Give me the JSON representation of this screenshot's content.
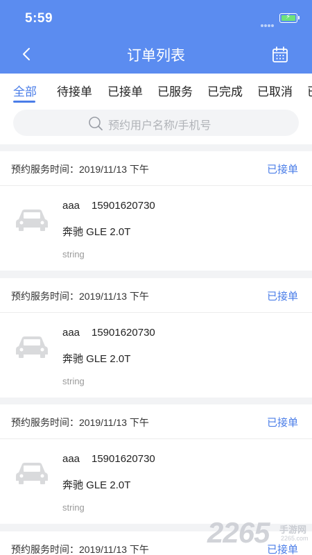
{
  "status_bar": {
    "time": "5:59"
  },
  "header": {
    "title": "订单列表"
  },
  "tabs": [
    {
      "label": "全部",
      "active": true
    },
    {
      "label": "待接单"
    },
    {
      "label": "已接单"
    },
    {
      "label": "已服务"
    },
    {
      "label": "已完成"
    },
    {
      "label": "已取消"
    },
    {
      "label": "已"
    }
  ],
  "search": {
    "placeholder": "预约用户名称/手机号"
  },
  "orders": [
    {
      "time_label": "预约服务时间：",
      "time": "2019/11/13 下午",
      "status": "已接单",
      "name": "aaa",
      "phone": "15901620730",
      "car": "奔驰 GLE 2.0T",
      "note": "string"
    },
    {
      "time_label": "预约服务时间：",
      "time": "2019/11/13 下午",
      "status": "已接单",
      "name": "aaa",
      "phone": "15901620730",
      "car": "奔驰 GLE 2.0T",
      "note": "string"
    },
    {
      "time_label": "预约服务时间：",
      "time": "2019/11/13 下午",
      "status": "已接单",
      "name": "aaa",
      "phone": "15901620730",
      "car": "奔驰 GLE 2.0T",
      "note": "string"
    },
    {
      "time_label": "预约服务时间：",
      "time": "2019/11/13 下午",
      "status": "已接单"
    }
  ],
  "watermark": {
    "number": "2265",
    "text": "手游网",
    "url": "2265.com"
  },
  "colors": {
    "header": "#5b8cf0",
    "accent": "#4a7de8",
    "page_bg": "#f2f3f5"
  },
  "icons": [
    "back-arrow-icon",
    "calendar-icon",
    "search-icon",
    "car-icon",
    "battery-icon"
  ]
}
